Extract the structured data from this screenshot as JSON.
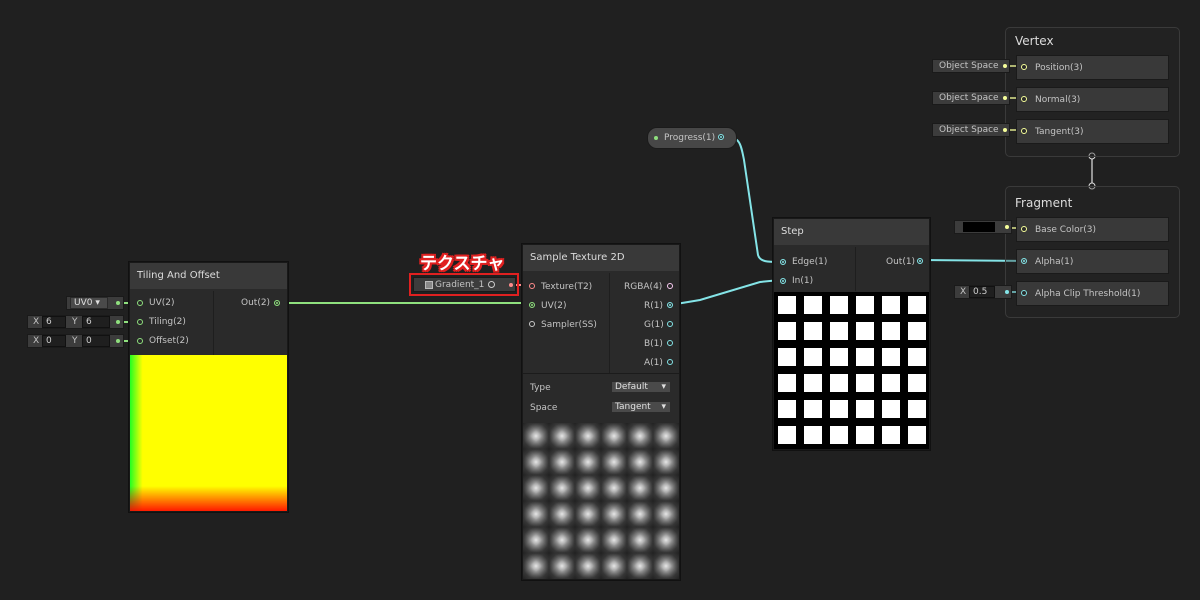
{
  "annotation": {
    "label": "テクスチャ",
    "color": "#e02020"
  },
  "colors": {
    "vec2": "#8fe07e",
    "vec1": "#84e4e7",
    "vec3": "#f6ff9a",
    "texture": "#ff8b8b",
    "sampler": "#c8c8c8",
    "vec4": "#fbcbf4"
  },
  "progress_node": {
    "label": "Progress(1)"
  },
  "tiling_node": {
    "title": "Tiling And Offset",
    "uv_dropdown": "UV0",
    "inputs": [
      "UV(2)",
      "Tiling(2)",
      "Offset(2)"
    ],
    "output": "Out(2)",
    "tiling": {
      "x_label": "X",
      "x": "6",
      "y_label": "Y",
      "y": "6"
    },
    "offset": {
      "x_label": "X",
      "x": "0",
      "y_label": "Y",
      "y": "0"
    }
  },
  "sample_node": {
    "title": "Sample Texture 2D",
    "texture_field": "Gradient_1",
    "inputs": [
      "Texture(T2)",
      "UV(2)",
      "Sampler(SS)"
    ],
    "outputs": [
      "RGBA(4)",
      "R(1)",
      "G(1)",
      "B(1)",
      "A(1)"
    ],
    "type_label": "Type",
    "type_value": "Default",
    "space_label": "Space",
    "space_value": "Tangent"
  },
  "step_node": {
    "title": "Step",
    "inputs": [
      "Edge(1)",
      "In(1)"
    ],
    "output": "Out(1)"
  },
  "vertex_stack": {
    "title": "Vertex",
    "blocks": [
      {
        "label": "Position(3)",
        "space": "Object Space"
      },
      {
        "label": "Normal(3)",
        "space": "Object Space"
      },
      {
        "label": "Tangent(3)",
        "space": "Object Space"
      }
    ]
  },
  "fragment_stack": {
    "title": "Fragment",
    "blocks": [
      {
        "label": "Base Color(3)"
      },
      {
        "label": "Alpha(1)"
      },
      {
        "label": "Alpha Clip Threshold(1)"
      }
    ],
    "base_color": "#000000",
    "alpha_clip": {
      "x_label": "X",
      "value": "0.5"
    }
  }
}
